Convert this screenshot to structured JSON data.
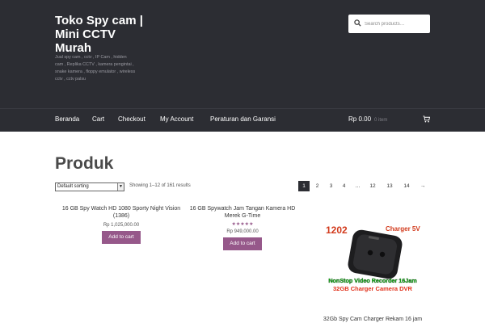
{
  "header": {
    "site_title": "Toko Spy cam | Mini CCTV Murah",
    "tagline": "Jual spy cam , cctv , IP Cam , hidden cam , Replika CCTV , kamera pengintai , snake kamera , floppy emulator , wireless cctv , cctv palsu",
    "search_placeholder": "Search products…"
  },
  "nav": {
    "items": [
      "Beranda",
      "Cart",
      "Checkout",
      "My Account",
      "Peraturan dan Garansi"
    ],
    "cart_total": "Rp 0.00",
    "cart_items": "0 item"
  },
  "main": {
    "title": "Produk",
    "sort_selected": "Default sorting",
    "result_count": "Showing 1–12 of 161 results",
    "pagination": [
      "1",
      "2",
      "3",
      "4",
      "…",
      "12",
      "13",
      "14",
      "→"
    ]
  },
  "products": [
    {
      "name": "16 GB Spy Watch HD 1080 Sporty Night Vision (1386)",
      "price": "Rp 1,025,000.00",
      "button": "Add to cart"
    },
    {
      "name": "16 GB Spywatch Jam Tangan Kamera HD Merek G-Time",
      "rating": 5,
      "price": "Rp 949,000.00",
      "button": "Add to cart"
    },
    {
      "name": "32Gb Spy Cam Charger Rekam 16 jam",
      "image_text": {
        "code": "1202",
        "charger": "Charger 5V",
        "line1": "NonStop Video Recorder 16Jam",
        "line2": "32GB Charger Camera DVR"
      }
    }
  ],
  "colors": {
    "header_bg": "#2c2d33",
    "accent": "#96588a",
    "title_text": "#4a4a4a"
  }
}
